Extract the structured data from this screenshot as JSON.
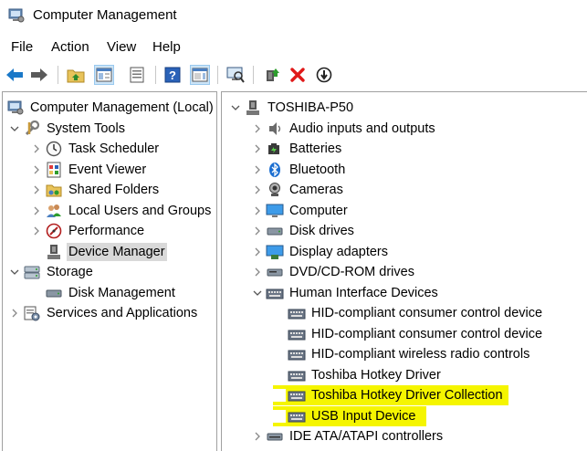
{
  "window": {
    "title": "Computer Management"
  },
  "menu": [
    "File",
    "Action",
    "View",
    "Help"
  ],
  "toolbar": {
    "colors": {
      "back": "#1a78c8",
      "forward": "#5a5a5a",
      "delete": "#e01818"
    },
    "buttons": [
      "back-arrow-icon",
      "forward-arrow-icon",
      "up-folder-icon",
      "show-hide-tree-icon",
      "properties-icon",
      "help-icon",
      "show-action-pane-icon",
      "scan-hardware-icon",
      "update-driver-icon",
      "uninstall-device-icon",
      "disable-device-icon"
    ]
  },
  "left_tree": {
    "root": "Computer Management (Local)",
    "system_tools": "System Tools",
    "task_scheduler": "Task Scheduler",
    "event_viewer": "Event Viewer",
    "shared_folders": "Shared Folders",
    "local_users": "Local Users and Groups",
    "performance": "Performance",
    "device_manager": "Device Manager",
    "storage": "Storage",
    "disk_management": "Disk Management",
    "services_apps": "Services and Applications"
  },
  "right_tree": {
    "computer_name": "TOSHIBA-P50",
    "categories": {
      "audio": "Audio inputs and outputs",
      "batteries": "Batteries",
      "bluetooth": "Bluetooth",
      "cameras": "Cameras",
      "computer": "Computer",
      "disk_drives": "Disk drives",
      "display_adapters": "Display adapters",
      "dvd": "DVD/CD-ROM drives",
      "hid": "Human Interface Devices",
      "ide": "IDE ATA/ATAPI controllers"
    },
    "hid_devices": [
      "HID-compliant consumer control device",
      "HID-compliant consumer control device",
      "HID-compliant wireless radio controls",
      "Toshiba Hotkey Driver",
      "Toshiba Hotkey Driver Collection",
      "USB Input Device"
    ]
  },
  "highlight_color": "#f5f500"
}
